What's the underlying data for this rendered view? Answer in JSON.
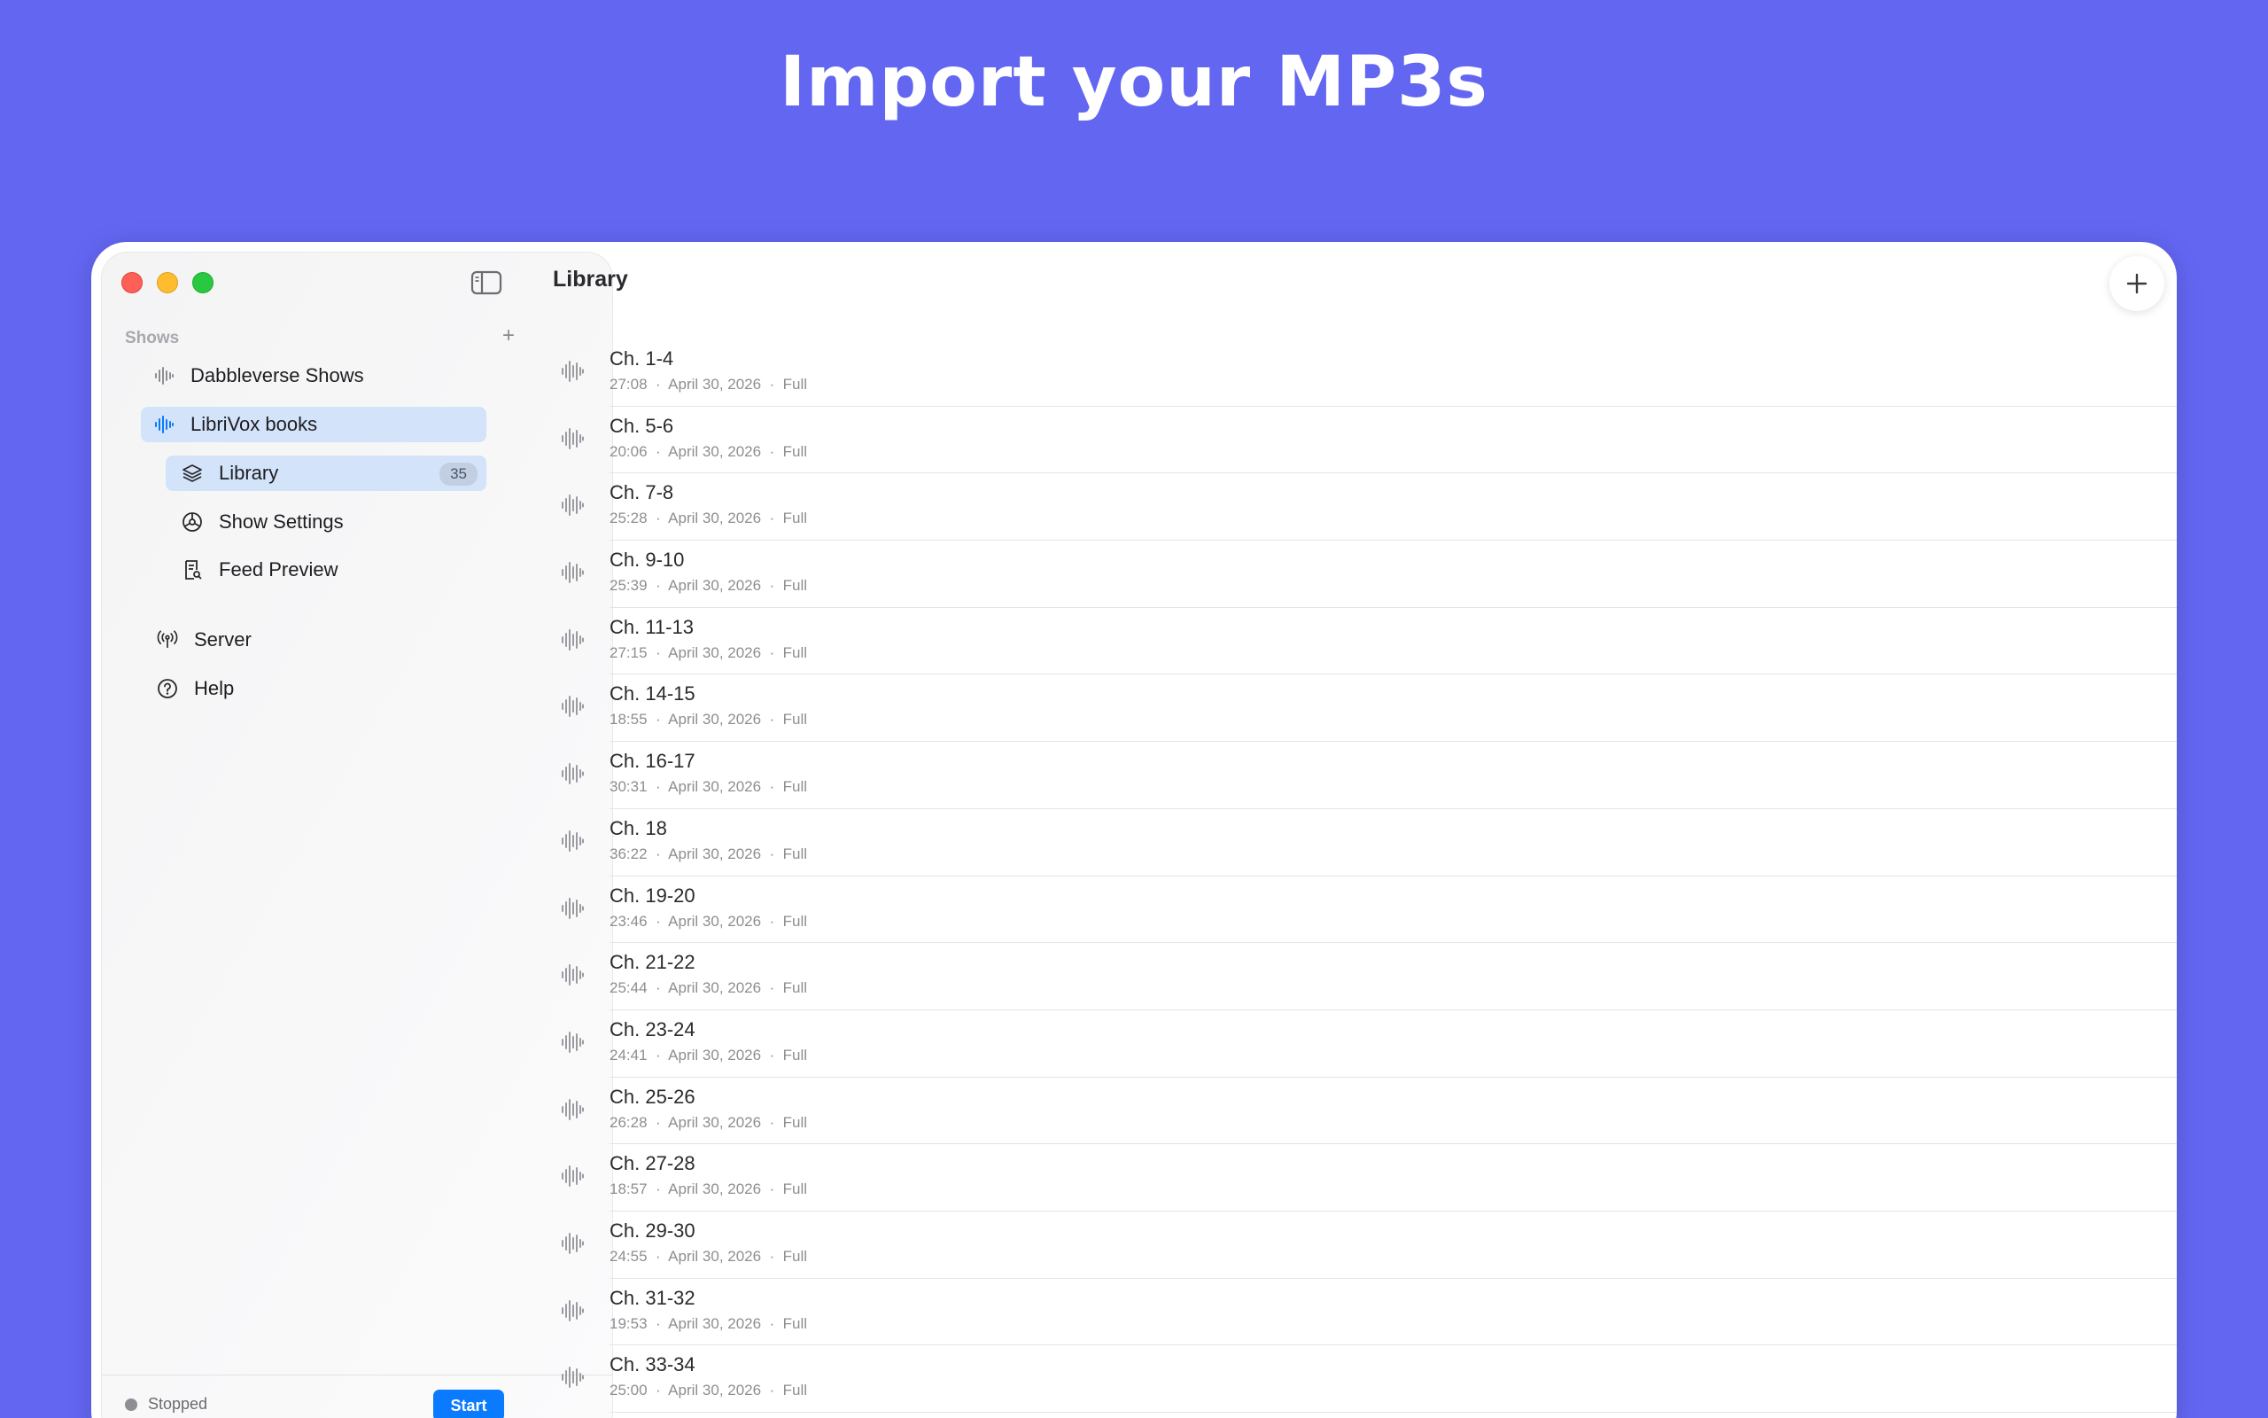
{
  "headline": "Import your MP3s",
  "sidebar": {
    "section_label": "Shows",
    "add_symbol": "+",
    "shows": [
      {
        "label": "Dabbleverse Shows"
      },
      {
        "label": "LibriVox books"
      }
    ],
    "sub_items": [
      {
        "label": "Library",
        "count": "35"
      },
      {
        "label": "Show Settings"
      },
      {
        "label": "Feed Preview"
      }
    ],
    "bottom_items": [
      {
        "label": "Server"
      },
      {
        "label": "Help"
      }
    ],
    "status": "Stopped",
    "start_label": "Start"
  },
  "main": {
    "title": "Library",
    "episodes": [
      {
        "title": "Ch. 1-4",
        "duration": "27:08",
        "date": "April 30, 2026",
        "type": "Full"
      },
      {
        "title": "Ch. 5-6",
        "duration": "20:06",
        "date": "April 30, 2026",
        "type": "Full"
      },
      {
        "title": "Ch. 7-8",
        "duration": "25:28",
        "date": "April 30, 2026",
        "type": "Full"
      },
      {
        "title": "Ch. 9-10",
        "duration": "25:39",
        "date": "April 30, 2026",
        "type": "Full"
      },
      {
        "title": "Ch. 11-13",
        "duration": "27:15",
        "date": "April 30, 2026",
        "type": "Full"
      },
      {
        "title": "Ch. 14-15",
        "duration": "18:55",
        "date": "April 30, 2026",
        "type": "Full"
      },
      {
        "title": "Ch. 16-17",
        "duration": "30:31",
        "date": "April 30, 2026",
        "type": "Full"
      },
      {
        "title": "Ch. 18",
        "duration": "36:22",
        "date": "April 30, 2026",
        "type": "Full"
      },
      {
        "title": "Ch. 19-20",
        "duration": "23:46",
        "date": "April 30, 2026",
        "type": "Full"
      },
      {
        "title": "Ch. 21-22",
        "duration": "25:44",
        "date": "April 30, 2026",
        "type": "Full"
      },
      {
        "title": "Ch. 23-24",
        "duration": "24:41",
        "date": "April 30, 2026",
        "type": "Full"
      },
      {
        "title": "Ch. 25-26",
        "duration": "26:28",
        "date": "April 30, 2026",
        "type": "Full"
      },
      {
        "title": "Ch. 27-28",
        "duration": "18:57",
        "date": "April 30, 2026",
        "type": "Full"
      },
      {
        "title": "Ch. 29-30",
        "duration": "24:55",
        "date": "April 30, 2026",
        "type": "Full"
      },
      {
        "title": "Ch. 31-32",
        "duration": "19:53",
        "date": "April 30, 2026",
        "type": "Full"
      },
      {
        "title": "Ch. 33-34",
        "duration": "25:00",
        "date": "April 30, 2026",
        "type": "Full"
      }
    ]
  },
  "colors": {
    "background": "#6366F1",
    "selection": "#D3E3FA",
    "accent": "#0A7AFF"
  }
}
